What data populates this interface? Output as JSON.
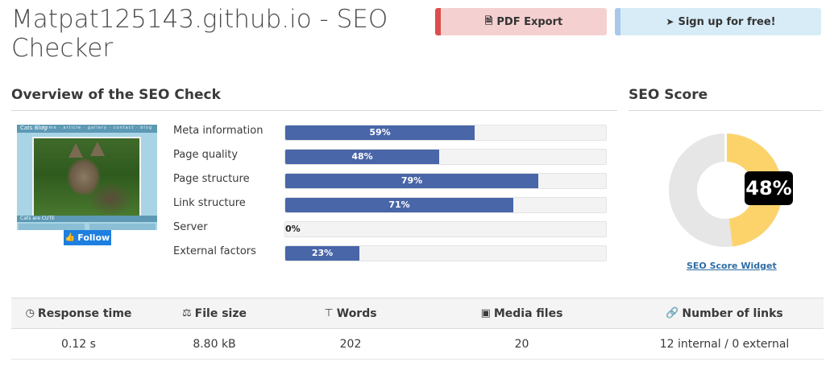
{
  "page": {
    "title": "Matpat125143.github.io - SEO Checker"
  },
  "buttons": {
    "pdf_export": "PDF Export",
    "pdf_icon": "file-pdf-icon",
    "signup": "Sign up for free!",
    "signup_icon": "arrow-circle-right-icon"
  },
  "overview": {
    "heading": "Overview of the SEO Check",
    "thumbnail": {
      "blog_name": "Cats Blog",
      "nav": "home  ·  article  ·  gallery  ·  contact  ·  blog",
      "section_label": "Cats are CUTE"
    },
    "follow_label": "Follow",
    "metrics": [
      {
        "label": "Meta information",
        "percent": 59,
        "display": "59%"
      },
      {
        "label": "Page quality",
        "percent": 48,
        "display": "48%"
      },
      {
        "label": "Page structure",
        "percent": 79,
        "display": "79%"
      },
      {
        "label": "Link structure",
        "percent": 71,
        "display": "71%"
      },
      {
        "label": "Server",
        "percent": 0,
        "display": "0%"
      },
      {
        "label": "External factors",
        "percent": 23,
        "display": "23%"
      }
    ],
    "bar_color": "#4866a8"
  },
  "seo_score": {
    "heading": "SEO Score",
    "value": 48,
    "display": "48%",
    "widget_link": "SEO Score Widget",
    "filled_color": "#fcd36b",
    "empty_color": "#e6e6e6"
  },
  "stats": {
    "headers": [
      {
        "label": "Response time",
        "icon": "gauge-icon"
      },
      {
        "label": "File size",
        "icon": "balance-scale-icon"
      },
      {
        "label": "Words",
        "icon": "text-height-icon"
      },
      {
        "label": "Media files",
        "icon": "image-icon"
      },
      {
        "label": "Number of links",
        "icon": "link-icon"
      }
    ],
    "values": [
      "0.12 s",
      "8.80 kB",
      "202",
      "20",
      "12 internal / 0 external"
    ]
  }
}
